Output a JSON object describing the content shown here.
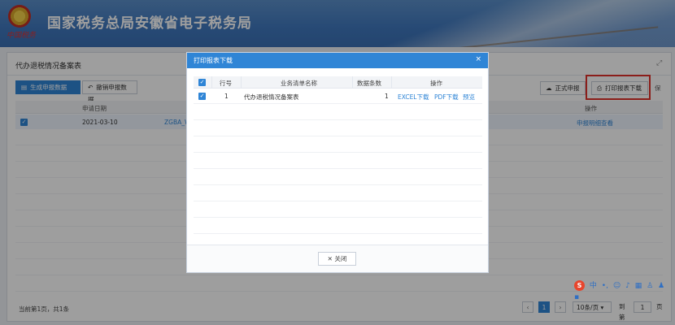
{
  "header": {
    "title": "国家税务总局安徽省电子税务局",
    "logo_text": "中国税务"
  },
  "panel": {
    "title": "代办退税情况备案表"
  },
  "toolbar": {
    "generate_label": "生成申报数据",
    "cancel_label": "撤销申报数据",
    "formal_label": "正式申报",
    "print_label": "打印报表下载",
    "extra_label": "保"
  },
  "grid": {
    "headers": {
      "date": "申请日期",
      "action": "操作"
    },
    "rows": [
      {
        "date": "2021-03-10",
        "code": "ZGBA_W",
        "action": "申报明细查看"
      }
    ]
  },
  "pager": {
    "summary": "当前第1页，共1条",
    "current_page": "1",
    "page_size": "10条/页",
    "goto_label": "到第",
    "goto_value": "1",
    "page_unit": "页"
  },
  "modal": {
    "title": "打印报表下载",
    "close_x": "×",
    "headers": {
      "row_no": "行号",
      "name": "业务清单名称",
      "count": "数据条数",
      "op": "操作"
    },
    "rows": [
      {
        "row_no": "1",
        "name": "代办退税情况备案表",
        "count": "1",
        "excel": "EXCEL下载",
        "pdf": "PDF下载",
        "preview": "预览"
      }
    ],
    "close_button": "关闭"
  },
  "ime": {
    "logo": "S",
    "zh": "中"
  }
}
